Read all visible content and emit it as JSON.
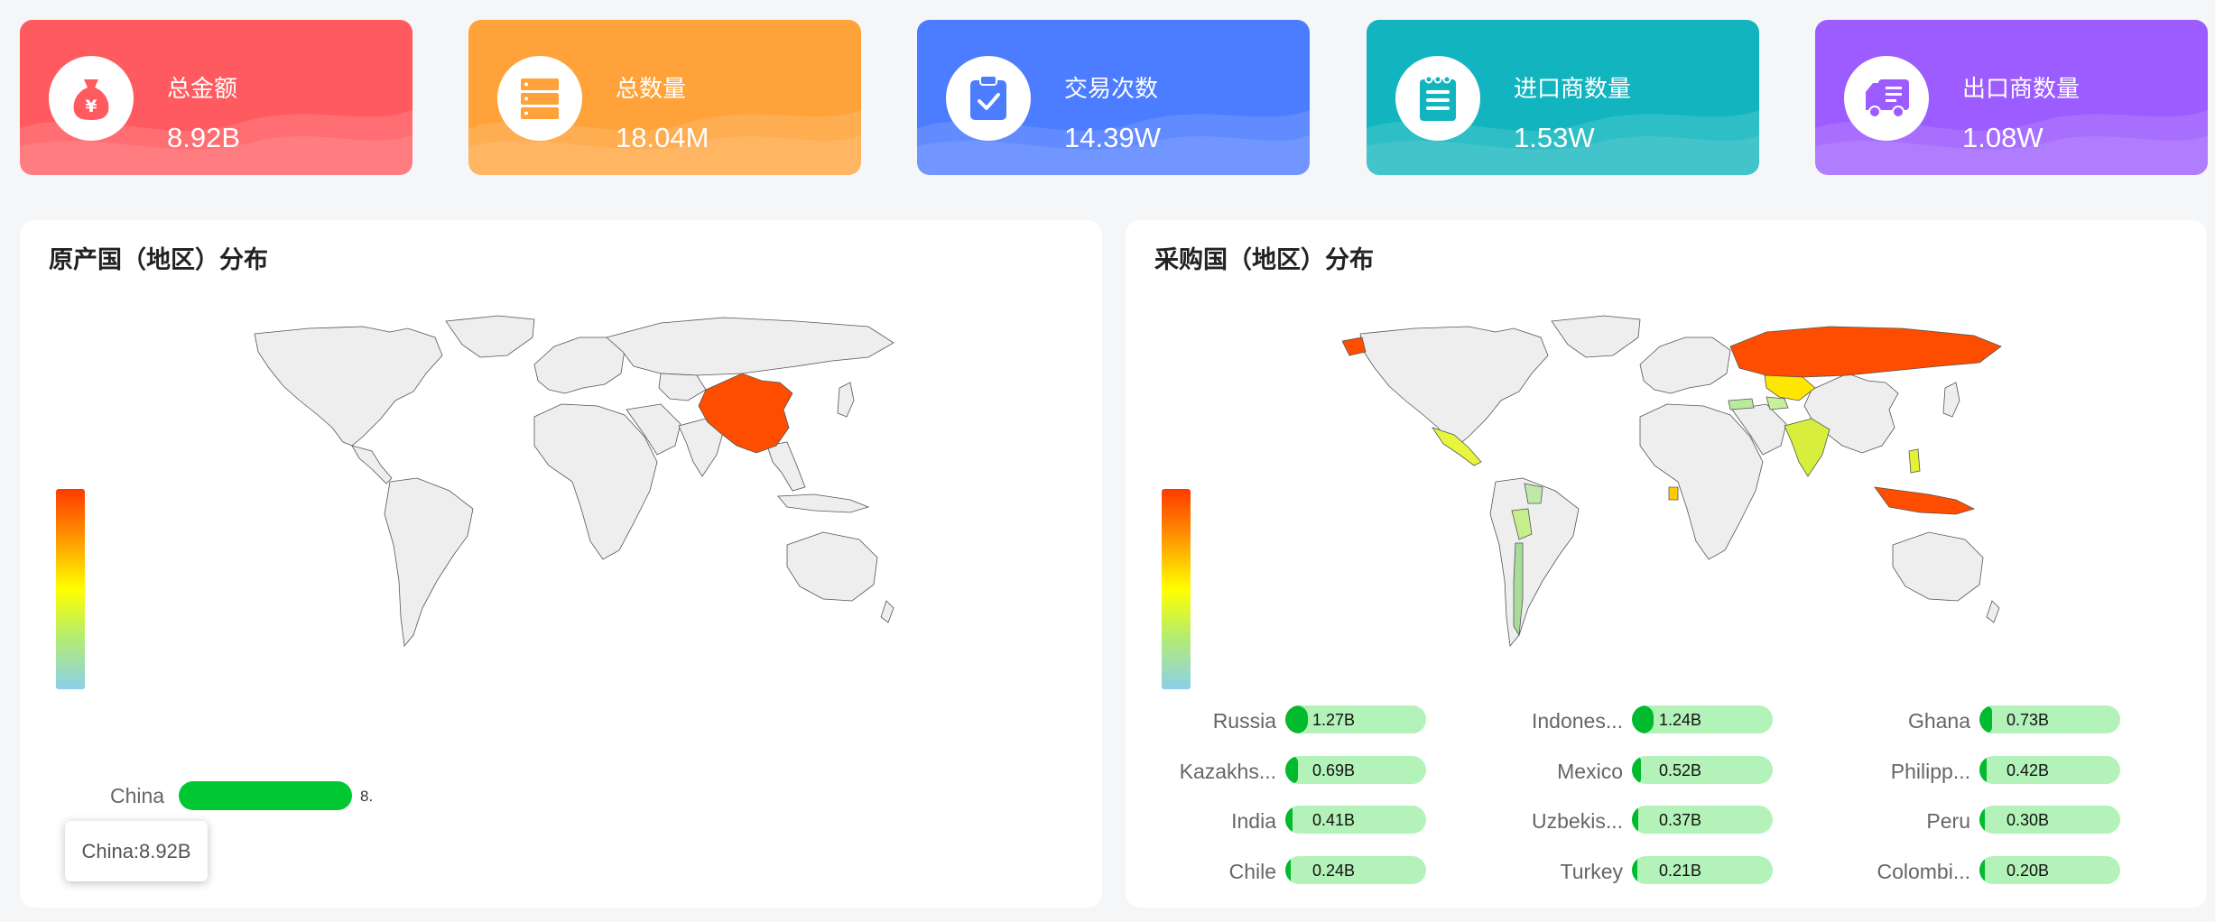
{
  "stats": [
    {
      "label": "总金额",
      "value": "8.92B",
      "icon": "money-bag-icon",
      "color": "#ff5a5f"
    },
    {
      "label": "总数量",
      "value": "18.04M",
      "icon": "database-stack-icon",
      "color": "#ffa23a"
    },
    {
      "label": "交易次数",
      "value": "14.39W",
      "icon": "clipboard-check-icon",
      "color": "#4c7cff"
    },
    {
      "label": "进口商数量",
      "value": "1.53W",
      "icon": "notepad-icon",
      "color": "#12b5bf"
    },
    {
      "label": "出口商数量",
      "value": "1.08W",
      "icon": "delivery-truck-icon",
      "color": "#9c5cff"
    }
  ],
  "origin_panel": {
    "title": "原产国（地区）分布",
    "rows": [
      {
        "name": "China",
        "value": "8."
      }
    ],
    "tooltip": "China:8.92B"
  },
  "purchaser_panel": {
    "title": "采购国（地区）分布",
    "rows": [
      {
        "name": "Russia",
        "value": "1.27B",
        "ratio": 1.27
      },
      {
        "name": "Indones...",
        "value": "1.24B",
        "ratio": 1.24
      },
      {
        "name": "Ghana",
        "value": "0.73B",
        "ratio": 0.73
      },
      {
        "name": "Kazakhs...",
        "value": "0.69B",
        "ratio": 0.69
      },
      {
        "name": "Mexico",
        "value": "0.52B",
        "ratio": 0.52
      },
      {
        "name": "Philipp...",
        "value": "0.42B",
        "ratio": 0.42
      },
      {
        "name": "India",
        "value": "0.41B",
        "ratio": 0.41
      },
      {
        "name": "Uzbekis...",
        "value": "0.37B",
        "ratio": 0.37
      },
      {
        "name": "Peru",
        "value": "0.30B",
        "ratio": 0.3
      },
      {
        "name": "Chile",
        "value": "0.24B",
        "ratio": 0.24
      },
      {
        "name": "Turkey",
        "value": "0.21B",
        "ratio": 0.21
      },
      {
        "name": "Colombi...",
        "value": "0.20B",
        "ratio": 0.2
      }
    ]
  },
  "colors": {
    "bar_fill": "#00c832",
    "bar_track": "#b3f2b8",
    "map_land": "#eeeeee",
    "map_highlight": "#ff4d00"
  }
}
